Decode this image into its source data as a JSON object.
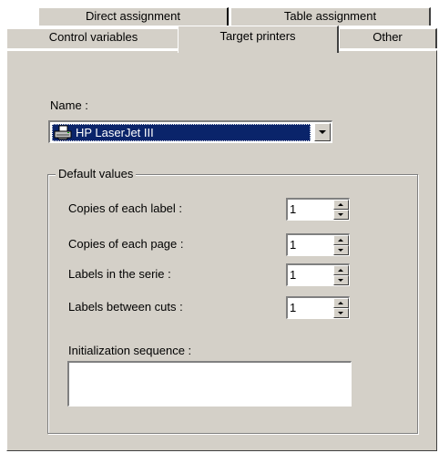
{
  "tabs": {
    "back_row": [
      {
        "label": "Direct assignment"
      },
      {
        "label": "Table assignment"
      }
    ],
    "front_row": [
      {
        "label": "Control variables"
      },
      {
        "label": "Target printers",
        "active": true
      },
      {
        "label": "Other"
      }
    ]
  },
  "printer": {
    "name_label": "Name :",
    "selected": "HP LaserJet III",
    "icon": "printer-icon"
  },
  "default_values": {
    "title": "Default values",
    "fields": [
      {
        "label": "Copies of each label :",
        "value": "1"
      },
      {
        "label": "Copies of each page :",
        "value": "1"
      },
      {
        "label": "Labels in the serie :",
        "value": "1"
      },
      {
        "label": "Labels between cuts :",
        "value": "1"
      }
    ],
    "init_sequence_label": "Initialization sequence :",
    "init_sequence_value": ""
  },
  "colors": {
    "face": "#d4d0c8",
    "selection": "#0a246a"
  }
}
